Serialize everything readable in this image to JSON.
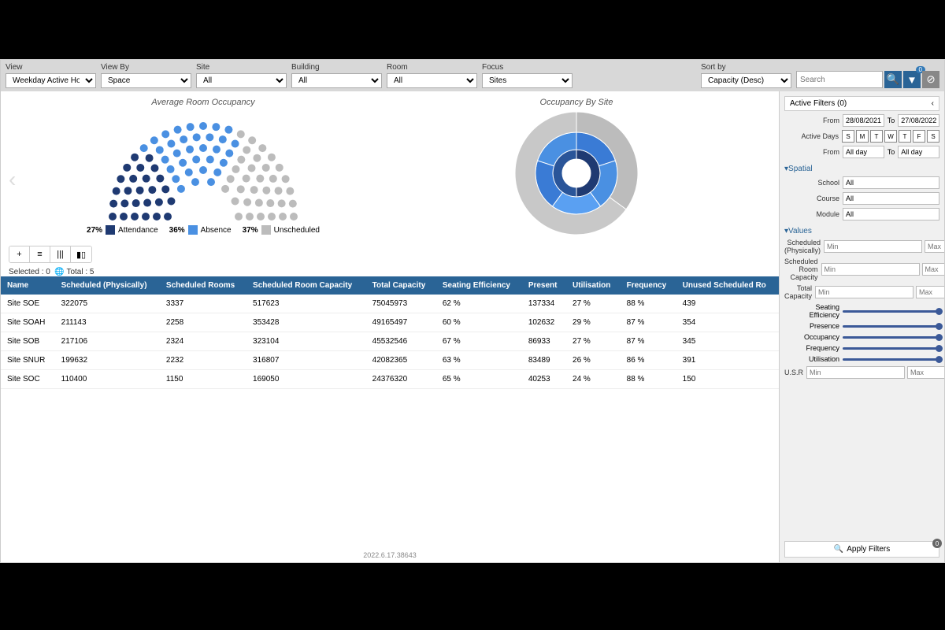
{
  "topbar": {
    "view_label": "View",
    "view_value": "Weekday Active Hours",
    "viewby_label": "View By",
    "viewby_value": "Space",
    "site_label": "Site",
    "site_value": "All",
    "building_label": "Building",
    "building_value": "All",
    "room_label": "Room",
    "room_value": "All",
    "focus_label": "Focus",
    "focus_value": "Sites",
    "sort_label": "Sort by",
    "sort_value": "Capacity (Desc)",
    "search_placeholder": "Search",
    "filter_badge": "0"
  },
  "charts": {
    "avg_title": "Average Room Occupancy",
    "site_title": "Occupancy By Site",
    "legend": [
      {
        "pct": "27%",
        "label": "Attendance",
        "color": "#1f3a72"
      },
      {
        "pct": "36%",
        "label": "Absence",
        "color": "#4a90e2"
      },
      {
        "pct": "37%",
        "label": "Unscheduled",
        "color": "#bcbcbc"
      }
    ]
  },
  "chart_data": [
    {
      "type": "pie",
      "title": "Average Room Occupancy",
      "series": [
        {
          "name": "Attendance",
          "value": 27,
          "color": "#1f3a72"
        },
        {
          "name": "Absence",
          "value": 36,
          "color": "#4a90e2"
        },
        {
          "name": "Unscheduled",
          "value": 37,
          "color": "#bcbcbc"
        }
      ]
    },
    {
      "type": "pie",
      "title": "Occupancy By Site",
      "rings": [
        {
          "name": "inner",
          "slices": [
            {
              "value": 50,
              "color": "#1f3a72"
            },
            {
              "value": 50,
              "color": "#2a5599"
            }
          ]
        },
        {
          "name": "mid",
          "slices": [
            {
              "value": 20,
              "color": "#3a7bd5"
            },
            {
              "value": 20,
              "color": "#4a90e2"
            },
            {
              "value": 20,
              "color": "#5aa0f2"
            },
            {
              "value": 20,
              "color": "#3a7bd5"
            },
            {
              "value": 20,
              "color": "#4a90e2"
            }
          ]
        },
        {
          "name": "outer",
          "slices": [
            {
              "value": 35,
              "color": "#bcbcbc"
            },
            {
              "value": 65,
              "color": "#c8c8c8"
            }
          ]
        }
      ]
    }
  ],
  "status": {
    "selected_label": "Selected :",
    "selected": "0",
    "total_label": "Total :",
    "total": "5"
  },
  "table": {
    "headers": [
      "Name",
      "Scheduled (Physically)",
      "Scheduled Rooms",
      "Scheduled Room Capacity",
      "Total Capacity",
      "Seating Efficiency",
      "Present",
      "Utilisation",
      "Frequency",
      "Unused Scheduled Ro"
    ],
    "rows": [
      [
        "Site SOE",
        "322075",
        "3337",
        "517623",
        "75045973",
        "62 %",
        "137334",
        "27 %",
        "88 %",
        "439"
      ],
      [
        "Site SOAH",
        "211143",
        "2258",
        "353428",
        "49165497",
        "60 %",
        "102632",
        "29 %",
        "87 %",
        "354"
      ],
      [
        "Site SOB",
        "217106",
        "2324",
        "323104",
        "45532546",
        "67 %",
        "86933",
        "27 %",
        "87 %",
        "345"
      ],
      [
        "Site SNUR",
        "199632",
        "2232",
        "316807",
        "42082365",
        "63 %",
        "83489",
        "26 %",
        "86 %",
        "391"
      ],
      [
        "Site SOC",
        "110400",
        "1150",
        "169050",
        "24376320",
        "65 %",
        "40253",
        "24 %",
        "88 %",
        "150"
      ]
    ]
  },
  "version": "2022.6.17.38643",
  "sidebar": {
    "active_filters": "Active Filters (0)",
    "from_label": "From",
    "from_date": "28/08/2021",
    "to_label": "To",
    "to_date": "27/08/2022",
    "days_label": "Active Days",
    "days": [
      "S",
      "M",
      "T",
      "W",
      "T",
      "F",
      "S"
    ],
    "time_from_label": "From",
    "time_from": "All day",
    "time_to_label": "To",
    "time_to": "All day",
    "spatial_title": "▾Spatial",
    "school_label": "School",
    "school_value": "All",
    "course_label": "Course",
    "course_value": "All",
    "module_label": "Module",
    "module_value": "All",
    "values_title": "▾Values",
    "sched_phys_label": "Scheduled (Physically)",
    "sched_cap_label": "Scheduled Room Capacity",
    "total_cap_label": "Total Capacity",
    "seat_eff_label": "Seating Efficiency",
    "presence_label": "Presence",
    "occupancy_label": "Occupancy",
    "frequency_label": "Frequency",
    "utilisation_label": "Utilisation",
    "usr_label": "U.S.R",
    "min_ph": "Min",
    "max_ph": "Max",
    "apply_label": "Apply Filters",
    "apply_badge": "0"
  }
}
